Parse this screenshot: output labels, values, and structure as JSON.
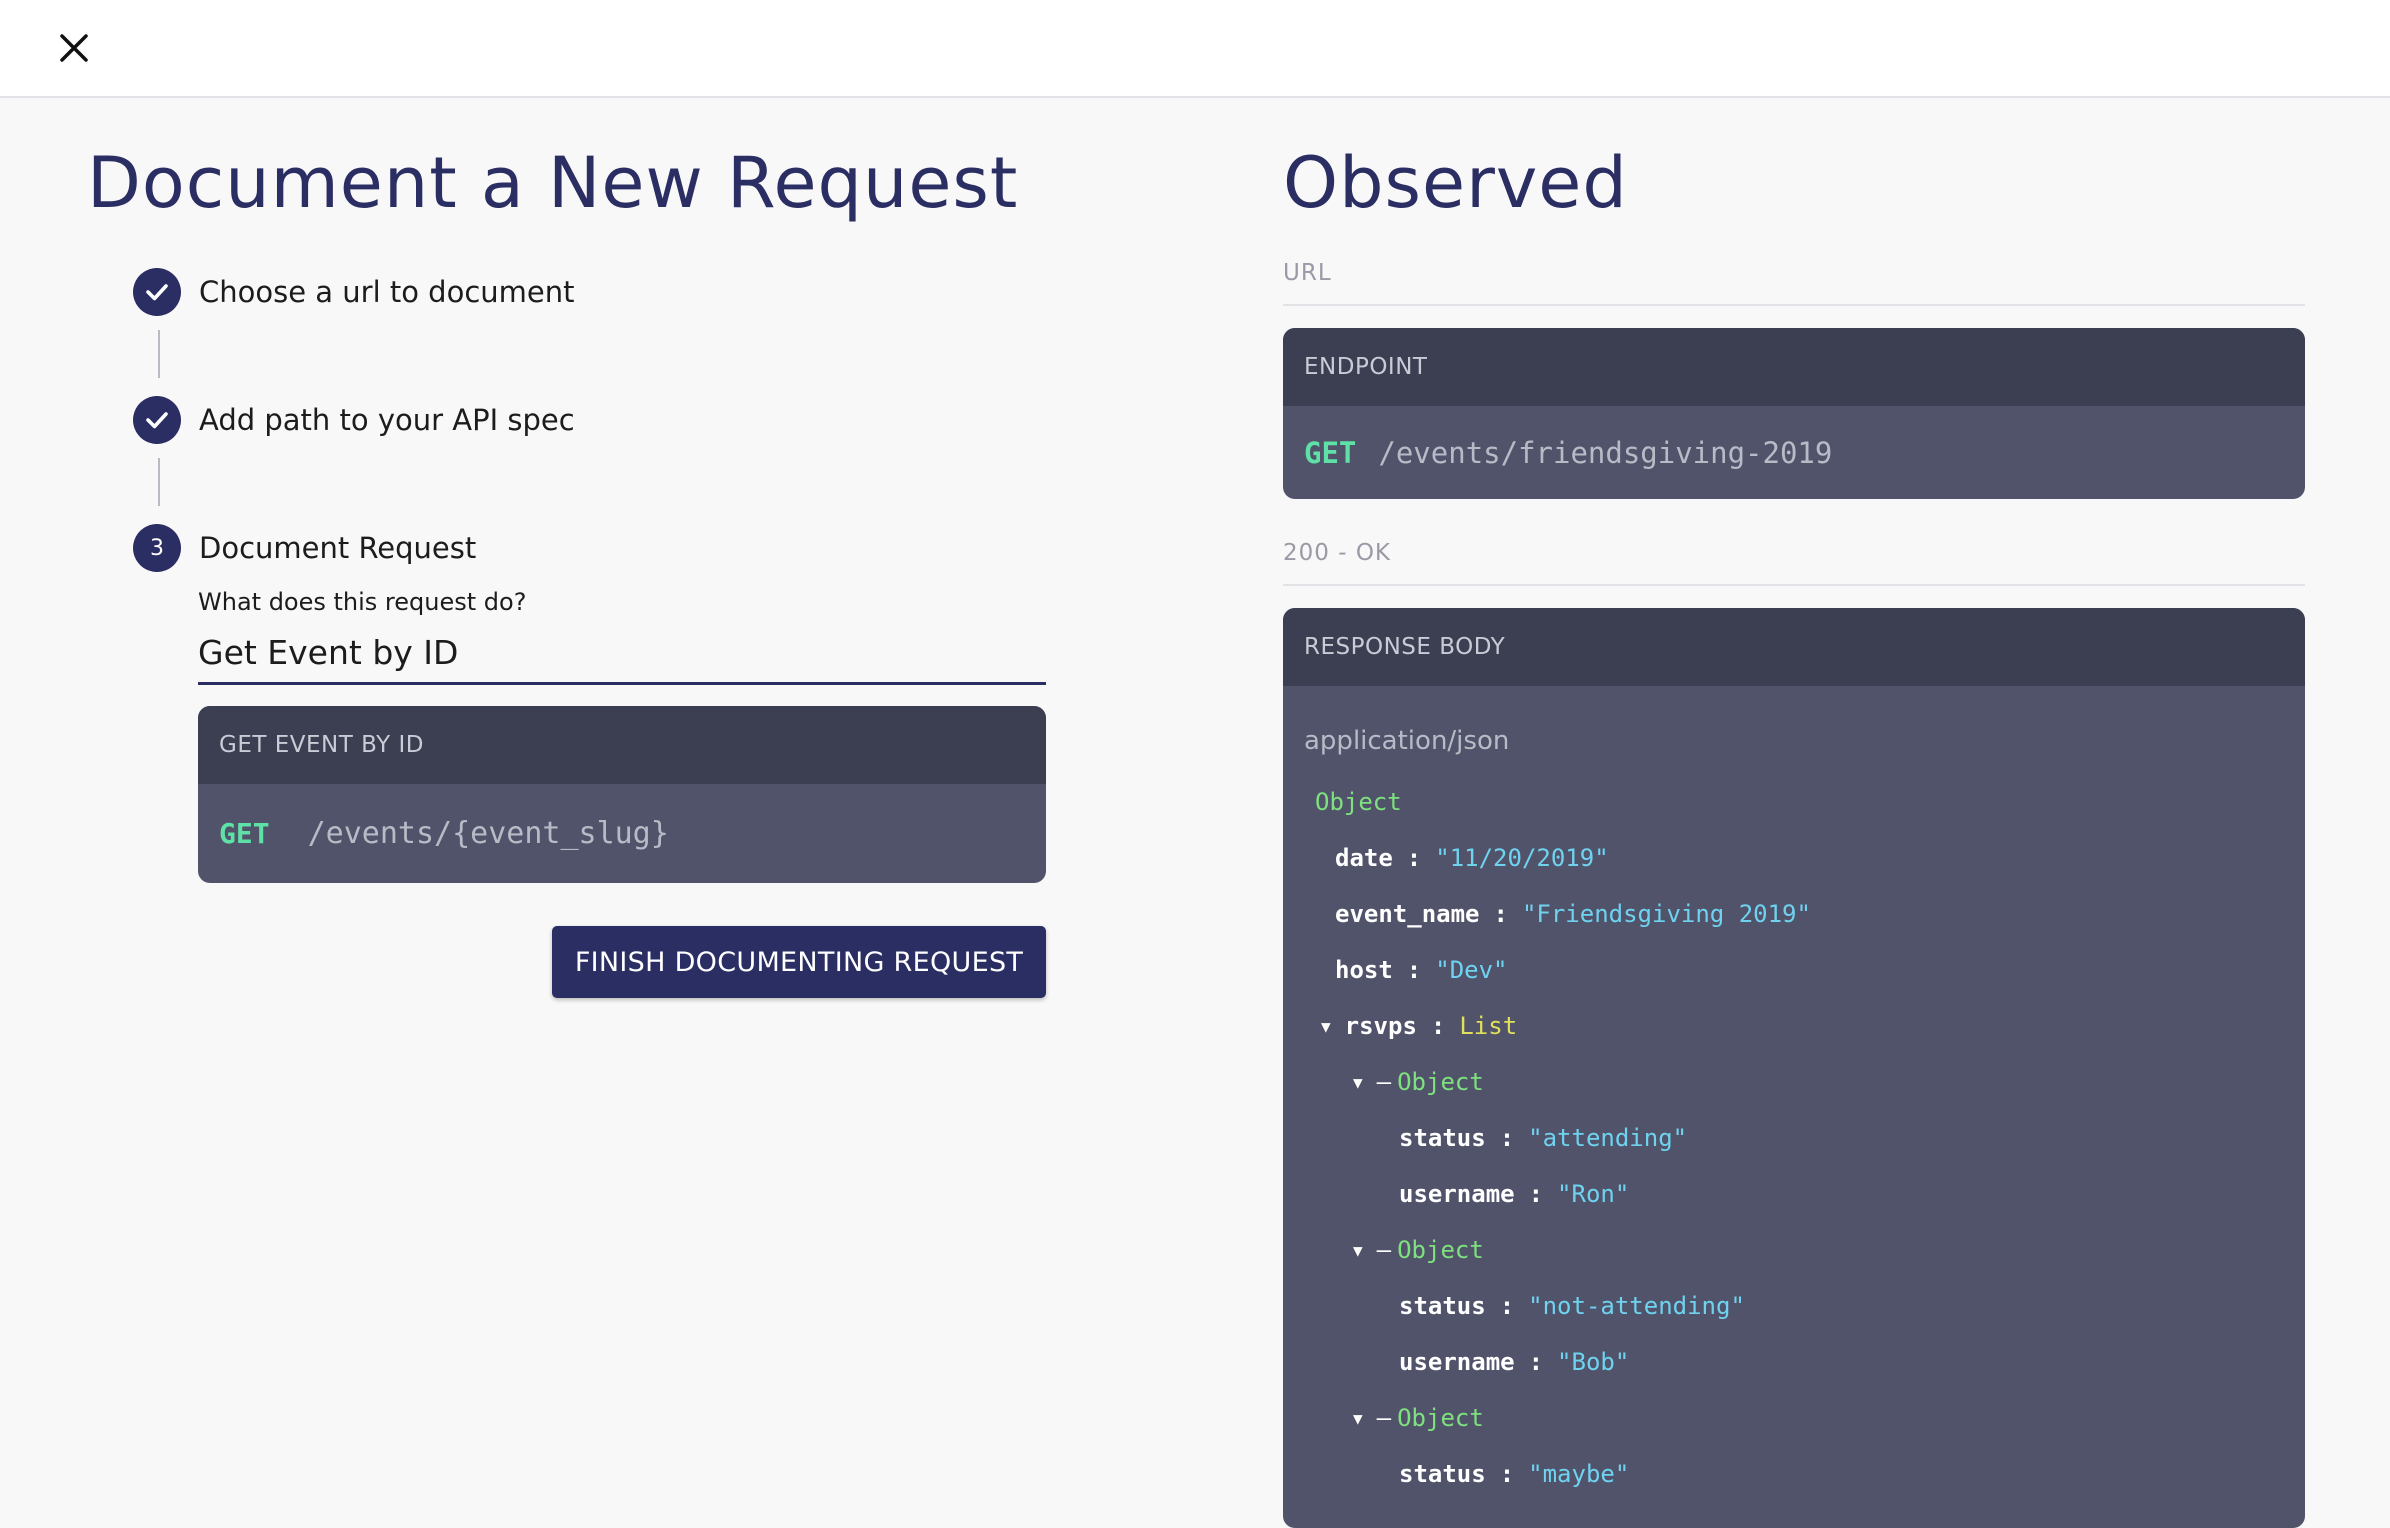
{
  "left": {
    "title": "Document a New Request",
    "steps": [
      {
        "number": "✓",
        "label": "Choose a url to document",
        "state": "done"
      },
      {
        "number": "✓",
        "label": "Add path to your API spec",
        "state": "done"
      },
      {
        "number": "3",
        "label": "Document Request",
        "state": "active"
      }
    ],
    "question": "What does this request do?",
    "request_name": "Get Event by ID",
    "card": {
      "header": "GET EVENT BY ID",
      "method": "GET",
      "path": "/events/{event_slug}"
    },
    "finish_button": "FINISH DOCUMENTING REQUEST"
  },
  "right": {
    "title": "Observed",
    "url_label": "URL",
    "endpoint": {
      "header": "ENDPOINT",
      "method": "GET",
      "path": "/events/friendsgiving-2019"
    },
    "status_label": "200 - OK",
    "response": {
      "header": "RESPONSE BODY",
      "content_type": "application/json",
      "root_type": "Object",
      "colon": ":",
      "fields": [
        {
          "key": "date",
          "value": "\"11/20/2019\""
        },
        {
          "key": "event_name",
          "value": "\"Friendsgiving 2019\""
        },
        {
          "key": "host",
          "value": "\"Dev\""
        }
      ],
      "rsvps": {
        "key": "rsvps",
        "type": "List",
        "items": [
          {
            "type": "Object",
            "status_key": "status",
            "status": "\"attending\"",
            "user_key": "username",
            "username": "\"Ron\""
          },
          {
            "type": "Object",
            "status_key": "status",
            "status": "\"not-attending\"",
            "user_key": "username",
            "username": "\"Bob\""
          },
          {
            "type": "Object",
            "status_key": "status",
            "status": "\"maybe\""
          }
        ]
      }
    }
  },
  "colors": {
    "primary": "#2b2e63",
    "card_header": "#3c3f52",
    "card_body": "#50536a",
    "method": "#5fe0a7",
    "string": "#6fd3f0",
    "type": "#7ee07e",
    "list": "#e0e05a"
  }
}
